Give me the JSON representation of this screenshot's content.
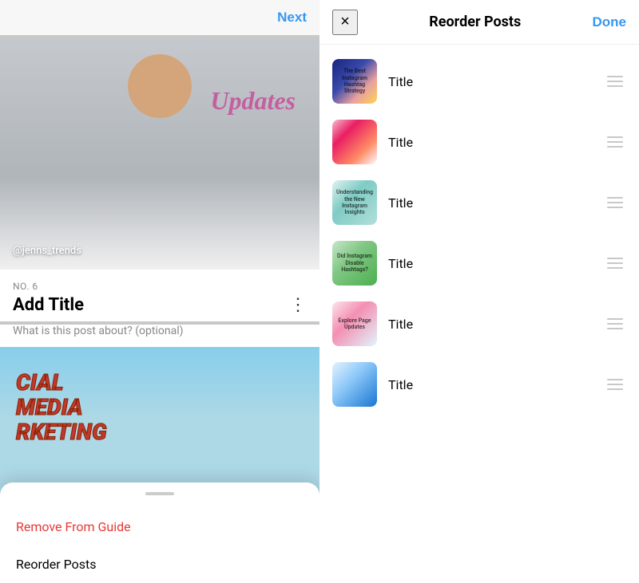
{
  "left": {
    "next_label": "Next",
    "post_number": "NO. 6",
    "post_title": "Add Title",
    "post_subtitle": "What is this post about? (optional)",
    "username": "@jenns_trends",
    "updates_text": "Updates",
    "bottom_sheet": {
      "handle_label": "",
      "remove_label": "Remove From Guide",
      "reorder_label": "Reorder Posts"
    }
  },
  "right": {
    "close_icon": "×",
    "panel_title": "Reorder Posts",
    "done_label": "Done",
    "posts": [
      {
        "title": "Title",
        "thumb_class": "thumb-1",
        "thumb_label": "The Best Instagram Hashtag Strategy"
      },
      {
        "title": "Title",
        "thumb_class": "thumb-2",
        "thumb_label": ""
      },
      {
        "title": "Title",
        "thumb_class": "thumb-3",
        "thumb_label": "Understanding the New Instagram Insights"
      },
      {
        "title": "Title",
        "thumb_class": "thumb-4",
        "thumb_label": "Did Instagram Disable Hashtags?"
      },
      {
        "title": "Title",
        "thumb_class": "thumb-5",
        "thumb_label": "Explore Page Updates"
      },
      {
        "title": "Title",
        "thumb_class": "thumb-6",
        "thumb_label": ""
      }
    ]
  }
}
